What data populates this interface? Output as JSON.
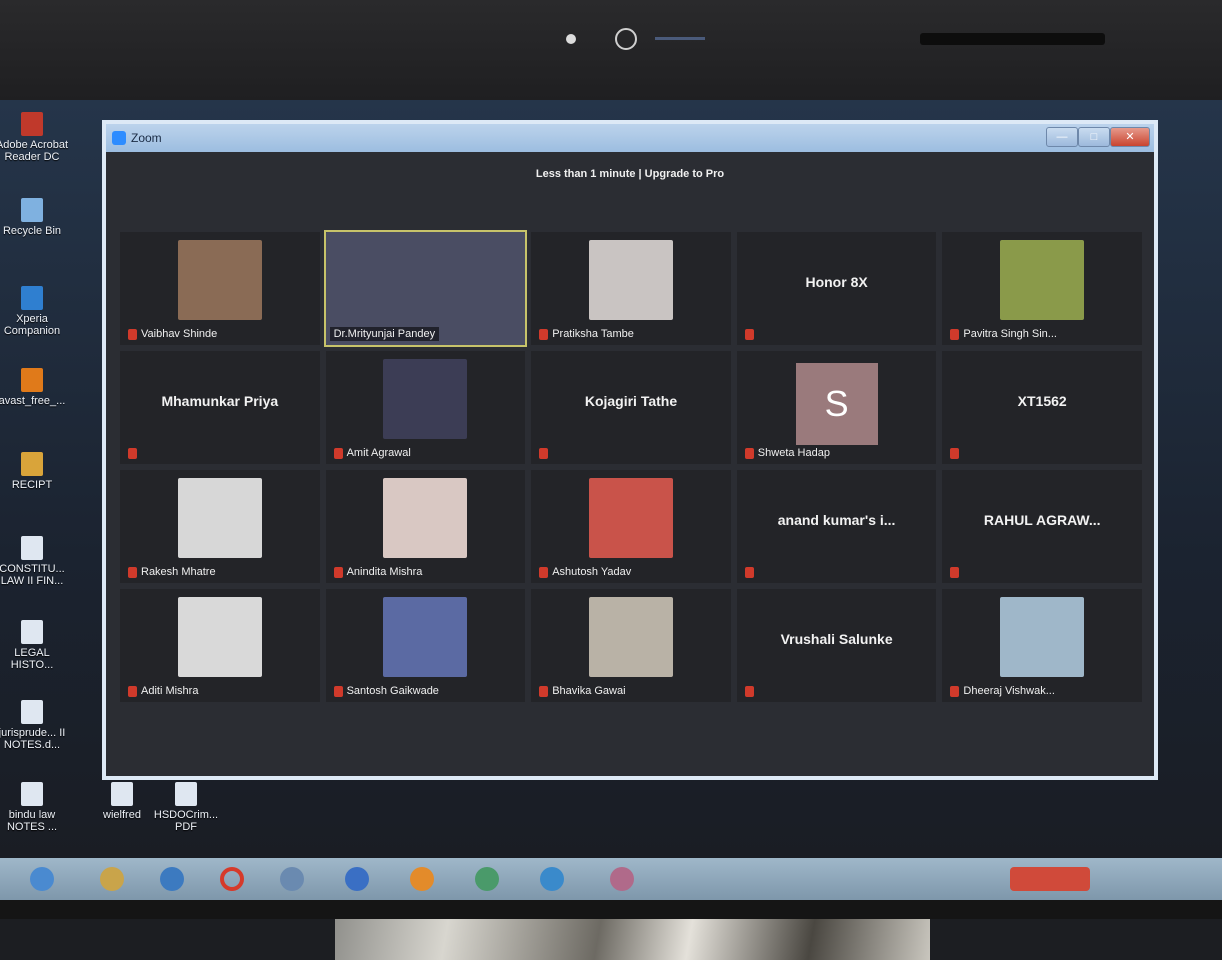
{
  "window": {
    "title": "Zoom",
    "banner": "Less than 1 minute | Upgrade to Pro",
    "controls": {
      "minimize": "—",
      "maximize": "□",
      "close": "✕"
    }
  },
  "desktop_icons": [
    {
      "label": "Adobe Acrobat Reader DC",
      "icon": "acrobat-icon"
    },
    {
      "label": "Recycle Bin",
      "icon": "recycle-bin-icon"
    },
    {
      "label": "Xperia Companion",
      "icon": "xperia-icon"
    },
    {
      "label": "avast_free_...",
      "icon": "avast-icon"
    },
    {
      "label": "RECIPT",
      "icon": "folder-icon"
    },
    {
      "label": "CONSTITU... LAW II FIN...",
      "icon": "document-icon"
    },
    {
      "label": "LEGAL HISTO...",
      "icon": "document-icon"
    },
    {
      "label": "jurisprude... II NOTES.d...",
      "icon": "document-icon"
    },
    {
      "label": "bindu law NOTES ...",
      "icon": "document-icon"
    },
    {
      "label": "wielfred",
      "icon": "document-icon"
    },
    {
      "label": "HSDOCrim... PDF",
      "icon": "pdf-icon"
    }
  ],
  "participants": [
    {
      "name": "Vaibhav Shinde",
      "type": "photo",
      "muted": true,
      "color": "#8a6b55"
    },
    {
      "name": "Dr.Mrityunjai Pandey",
      "type": "video",
      "muted": false,
      "active": true,
      "color": "#4a4d63"
    },
    {
      "name": "Pratiksha Tambe",
      "type": "photo",
      "muted": true,
      "color": "#c9c4c2"
    },
    {
      "name": "Honor 8X",
      "type": "name",
      "muted": true
    },
    {
      "name": "Pavitra Singh Sin...",
      "type": "photo",
      "muted": true,
      "color": "#8a9a4a"
    },
    {
      "name": "Mhamunkar Priya",
      "type": "name",
      "muted": true
    },
    {
      "name": "Amit Agrawal",
      "type": "photo",
      "muted": true,
      "color": "#3c3d55"
    },
    {
      "name": "Kojagiri Tathe",
      "type": "name",
      "muted": true
    },
    {
      "name": "Shweta Hadap",
      "type": "avatar",
      "initial": "S",
      "muted": true
    },
    {
      "name": "XT1562",
      "type": "name",
      "muted": true
    },
    {
      "name": "Rakesh Mhatre",
      "type": "photo",
      "muted": true,
      "color": "#d7d7d7"
    },
    {
      "name": "Anindita Mishra",
      "type": "photo",
      "muted": true,
      "color": "#d9c8c3"
    },
    {
      "name": "Ashutosh Yadav",
      "type": "photo",
      "muted": true,
      "color": "#c9534a"
    },
    {
      "name": "anand kumar's i...",
      "type": "name",
      "muted": true
    },
    {
      "name": "RAHUL AGRAW...",
      "type": "name",
      "muted": true
    },
    {
      "name": "Aditi Mishra",
      "type": "photo",
      "muted": true,
      "color": "#d9d9d9"
    },
    {
      "name": "Santosh Gaikwade",
      "type": "photo",
      "muted": true,
      "color": "#5b6aa3"
    },
    {
      "name": "Bhavika Gawai",
      "type": "photo",
      "muted": true,
      "color": "#b9b2a6"
    },
    {
      "name": "Vrushali Salunke",
      "type": "name",
      "muted": true
    },
    {
      "name": "Dheeraj Vishwak...",
      "type": "photo",
      "muted": true,
      "color": "#9fb7c9"
    }
  ]
}
